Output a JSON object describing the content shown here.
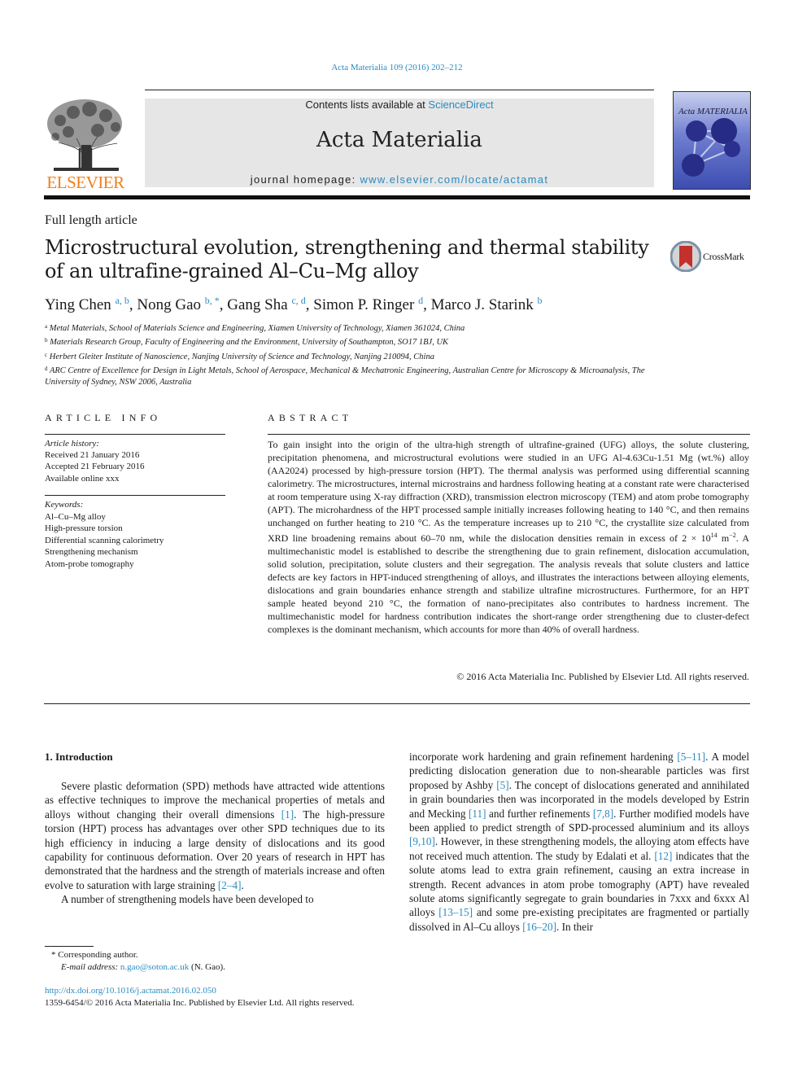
{
  "header": {
    "citation": "Acta Materialia 109 (2016) 202–212",
    "publisher_logo_text": "ELSEVIER",
    "contents_prefix": "Contents lists available at ",
    "contents_link": "ScienceDirect",
    "journal_name": "Acta Materialia",
    "homepage_prefix": "journal homepage: ",
    "homepage_link": "www.elsevier.com/locate/actamat",
    "cover_title": "Acta MATERIALIA",
    "crossmark_label": "CrossMark"
  },
  "article": {
    "type": "Full length article",
    "title": "Microstructural evolution, strengthening and thermal stability of an ultrafine-grained Al–Cu–Mg alloy",
    "authors": [
      {
        "name": "Ying Chen",
        "sup": "a, b"
      },
      {
        "name": "Nong Gao",
        "sup": "b, *"
      },
      {
        "name": "Gang Sha",
        "sup": "c, d"
      },
      {
        "name": "Simon P. Ringer",
        "sup": "d"
      },
      {
        "name": "Marco J. Starink",
        "sup": "b"
      }
    ],
    "affiliations": [
      {
        "key": "a",
        "text": "Metal Materials, School of Materials Science and Engineering, Xiamen University of Technology, Xiamen 361024, China"
      },
      {
        "key": "b",
        "text": "Materials Research Group, Faculty of Engineering and the Environment, University of Southampton, SO17 1BJ, UK"
      },
      {
        "key": "c",
        "text": "Herbert Gleiter Institute of Nanoscience, Nanjing University of Science and Technology, Nanjing 210094, China"
      },
      {
        "key": "d",
        "text": "ARC Centre of Excellence for Design in Light Metals, School of Aerospace, Mechanical & Mechatronic Engineering, Australian Centre for Microscopy & Microanalysis, The University of Sydney, NSW 2006, Australia"
      }
    ]
  },
  "article_info": {
    "heading": "ARTICLE INFO",
    "history_label": "Article history:",
    "history": [
      "Received 21 January 2016",
      "Accepted 21 February 2016",
      "Available online xxx"
    ],
    "keywords_label": "Keywords:",
    "keywords": [
      "Al–Cu–Mg alloy",
      "High-pressure torsion",
      "Differential scanning calorimetry",
      "Strengthening mechanism",
      "Atom-probe tomography"
    ]
  },
  "abstract": {
    "heading": "ABSTRACT",
    "text_part1": "To gain insight into the origin of the ultra-high strength of ultrafine-grained (UFG) alloys, the solute clustering, precipitation phenomena, and microstructural evolutions were studied in an UFG Al-4.63Cu-1.51 Mg (wt.%) alloy (AA2024) processed by high-pressure torsion (HPT). The thermal analysis was performed using differential scanning calorimetry. The microstructures, internal microstrains and hardness following heating at a constant rate were characterised at room temperature using X-ray diffraction (XRD), transmission electron microscopy (TEM) and atom probe tomography (APT). The microhardness of the HPT processed sample initially increases following heating to 140 °C, and then remains unchanged on further heating to 210 °C. As the temperature increases up to 210 °C, the crystallite size calculated from XRD line broadening remains about 60–70 nm, while the dislocation densities remain in excess of 2 × 10",
    "exp1": "14",
    "unit": " m",
    "exp2": "−2",
    "text_part2": ". A multimechanistic model is established to describe the strengthening due to grain refinement, dislocation accumulation, solid solution, precipitation, solute clusters and their segregation. The analysis reveals that solute clusters and lattice defects are key factors in HPT-induced strengthening of alloys, and illustrates the interactions between alloying elements, dislocations and grain boundaries enhance strength and stabilize ultrafine microstructures. Furthermore, for an HPT sample heated beyond 210 °C, the formation of nano-precipitates also contributes to hardness increment. The multimechanistic model for hardness contribution indicates the short-range order strengthening due to cluster-defect complexes is the dominant mechanism, which accounts for more than 40% of overall hardness.",
    "copyright": "© 2016 Acta Materialia Inc. Published by Elsevier Ltd. All rights reserved."
  },
  "intro": {
    "heading": "1.  Introduction",
    "left_p1": [
      {
        "t": "Severe plastic deformation (SPD) methods have attracted wide attentions as effective techniques to improve the mechanical properties of metals and alloys without changing their overall dimensions "
      },
      {
        "ref": "[1]"
      },
      {
        "t": ". The high-pressure torsion (HPT) process has advantages over other SPD techniques due to its high efficiency in inducing a large density of dislocations and its good capability for continuous deformation. Over 20 years of research in HPT has demonstrated that the hardness and the strength of materials increase and often evolve to saturation with large straining "
      },
      {
        "ref": "[2–4]"
      },
      {
        "t": "."
      }
    ],
    "left_p2": "A number of strengthening models have been developed to",
    "right_p": [
      {
        "t": "incorporate work hardening and grain refinement hardening "
      },
      {
        "ref": "[5–11]"
      },
      {
        "t": ". A model predicting dislocation generation due to non-shearable particles was first proposed by Ashby "
      },
      {
        "ref": "[5]"
      },
      {
        "t": ". The concept of dislocations generated and annihilated in grain boundaries then was incorporated in the models developed by Estrin and Mecking "
      },
      {
        "ref": "[11]"
      },
      {
        "t": " and further refinements "
      },
      {
        "ref": "[7,8]"
      },
      {
        "t": ". Further modified models have been applied to predict strength of SPD-processed aluminium and its alloys "
      },
      {
        "ref": "[9,10]"
      },
      {
        "t": ". However, in these strengthening models, the alloying atom effects have not received much attention. The study by Edalati et al. "
      },
      {
        "ref": "[12]"
      },
      {
        "t": " indicates that the solute atoms lead to extra grain refinement, causing an extra increase in strength. Recent advances in atom probe tomography (APT) have revealed solute atoms significantly segregate to grain boundaries in 7xxx and 6xxx Al alloys "
      },
      {
        "ref": "[13–15]"
      },
      {
        "t": " and some pre-existing precipitates are fragmented or partially dissolved in Al–Cu alloys "
      },
      {
        "ref": "[16–20]"
      },
      {
        "t": ". In their"
      }
    ]
  },
  "footer": {
    "corresponding": "* Corresponding author.",
    "email_label": "E-mail address: ",
    "email": "n.gao@soton.ac.uk",
    "email_suffix": " (N. Gao).",
    "doi": "http://dx.doi.org/10.1016/j.actamat.2016.02.050",
    "issn": "1359-6454/© 2016 Acta Materialia Inc. Published by Elsevier Ltd. All rights reserved."
  },
  "colors": {
    "link": "#2a8bbf",
    "elsevier_orange": "#f07f1b",
    "masthead_bg": "#e6e6e6"
  }
}
